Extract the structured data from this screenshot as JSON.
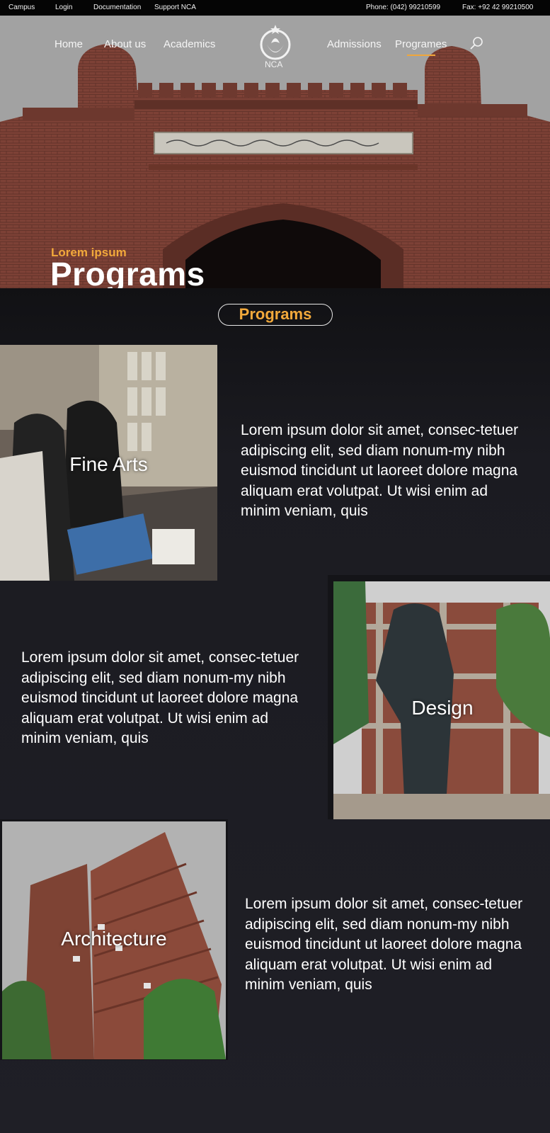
{
  "topbar": {
    "campus": "Campus",
    "login": "Login",
    "documentation": "Documentation",
    "support": "Support NCA",
    "phone": "Phone: (042) 99210599",
    "fax": "Fax: +92 42 99210500"
  },
  "nav": {
    "home": "Home",
    "about": "About us",
    "academics": "Academics",
    "logo_text": "NCA",
    "admissions": "Admissions",
    "programes": "Programes",
    "active_color": "#f0a63a"
  },
  "hero": {
    "subtitle": "Lorem ipsum",
    "title": "Programs"
  },
  "section": {
    "pill_label": "Programs",
    "accent": "#f2a93b"
  },
  "programs": [
    {
      "label": "Fine Arts",
      "description": "Lorem ipsum dolor sit amet, consec-tetuer adipiscing elit, sed diam nonum-my nibh euismod tincidunt ut laoreet dolore magna aliquam erat volutpat. Ut wisi enim ad minim veniam, quis"
    },
    {
      "label": "Design",
      "description": "Lorem ipsum dolor sit amet, consec-tetuer adipiscing elit, sed diam nonum-my nibh euismod tincidunt ut laoreet dolore magna aliquam erat volutpat. Ut wisi enim ad minim veniam, quis"
    },
    {
      "label": "Architecture",
      "description": "Lorem ipsum dolor sit amet, consec-tetuer adipiscing elit, sed diam nonum-my nibh euismod tincidunt ut laoreet dolore magna aliquam erat volutpat. Ut wisi enim ad minim veniam, quis"
    }
  ]
}
